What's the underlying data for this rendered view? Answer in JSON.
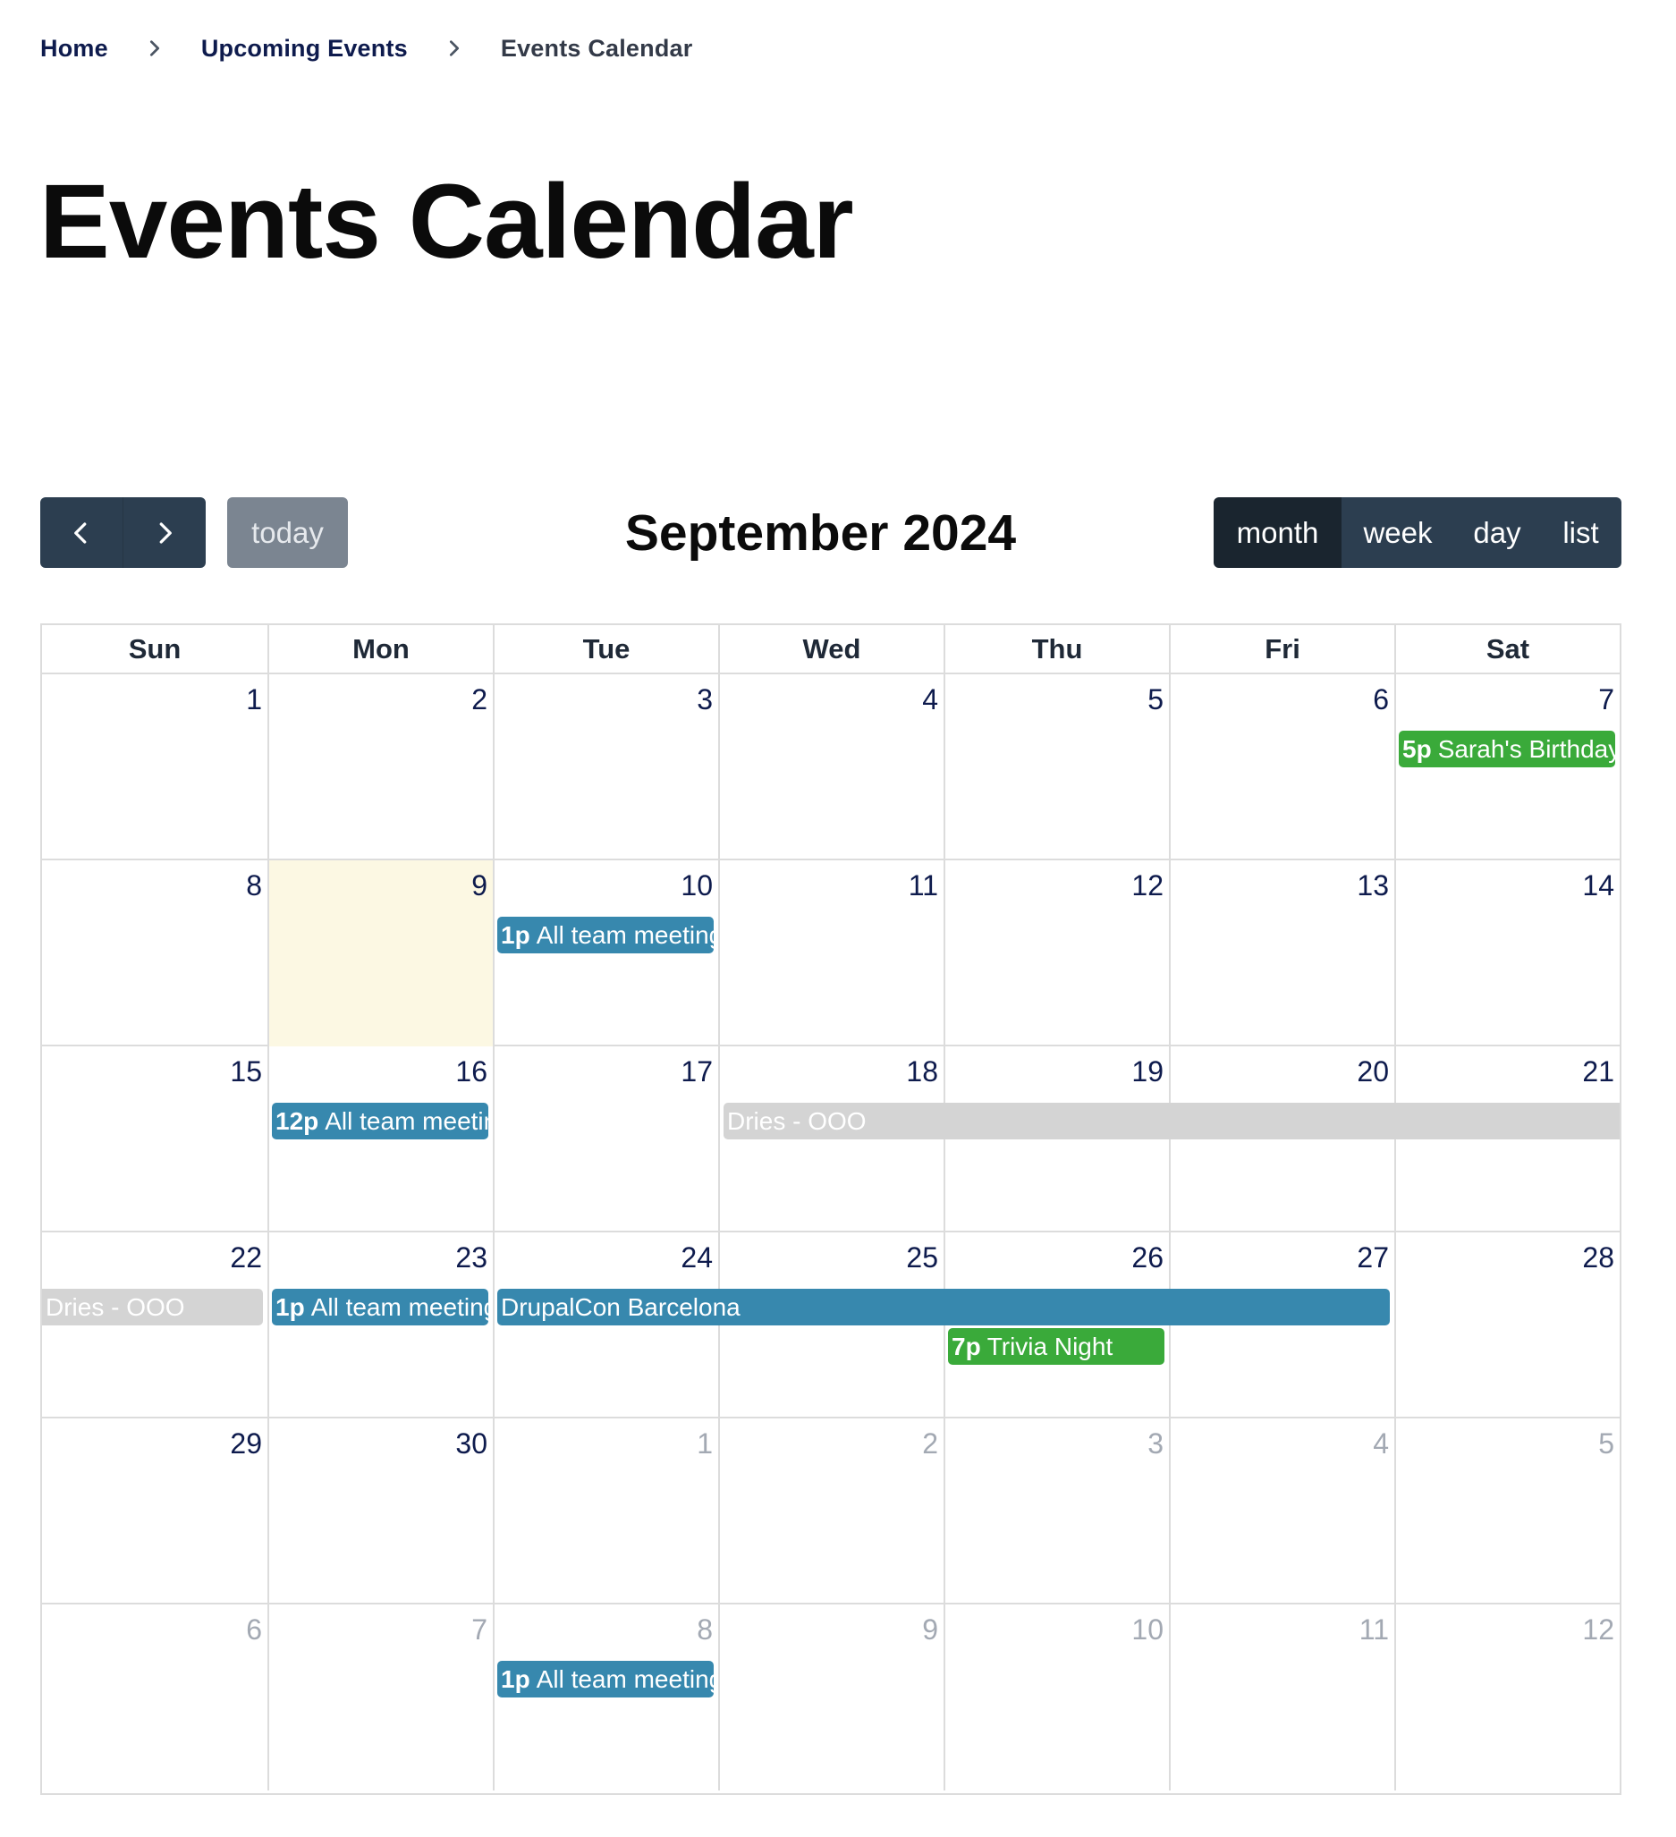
{
  "breadcrumb": {
    "home": "Home",
    "upcoming": "Upcoming Events",
    "current": "Events Calendar"
  },
  "page_title": "Events Calendar",
  "toolbar": {
    "today_label": "today",
    "month_title": "September 2024",
    "views": [
      "month",
      "week",
      "day",
      "list"
    ],
    "active_view": "month"
  },
  "weekdays": [
    "Sun",
    "Mon",
    "Tue",
    "Wed",
    "Thu",
    "Fri",
    "Sat"
  ],
  "weeks": [
    {
      "days": [
        "1",
        "2",
        "3",
        "4",
        "5",
        "6",
        "7"
      ]
    },
    {
      "days": [
        "8",
        "9",
        "10",
        "11",
        "12",
        "13",
        "14"
      ]
    },
    {
      "days": [
        "15",
        "16",
        "17",
        "18",
        "19",
        "20",
        "21"
      ]
    },
    {
      "days": [
        "22",
        "23",
        "24",
        "25",
        "26",
        "27",
        "28"
      ]
    },
    {
      "days": [
        "29",
        "30",
        "1",
        "2",
        "3",
        "4",
        "5"
      ]
    },
    {
      "days": [
        "6",
        "7",
        "8",
        "9",
        "10",
        "11",
        "12"
      ]
    }
  ],
  "events": {
    "sarah": {
      "time": "5p",
      "title": "Sarah's Birthday"
    },
    "team_10": {
      "time": "1p",
      "title": "All team meeting"
    },
    "team_16": {
      "time": "12p",
      "title": "All team meeting"
    },
    "dries_1": {
      "title": "Dries - OOO"
    },
    "dries_2": {
      "title": "Dries - OOO"
    },
    "team_23": {
      "time": "1p",
      "title": "All team meeting"
    },
    "drupalcon": {
      "title": "DrupalCon Barcelona"
    },
    "trivia": {
      "time": "7p",
      "title": "Trivia Night"
    },
    "team_oct8": {
      "time": "1p",
      "title": "All team meeting"
    }
  },
  "colors": {
    "toolbar_button": "#2c3e50",
    "toolbar_active": "#1a252f",
    "today_button": "#7b8591",
    "event_blue": "#3788ae",
    "event_green": "#3aaa3a",
    "event_grey": "#d4d4d4",
    "today_highlight": "#fcf8e3"
  }
}
